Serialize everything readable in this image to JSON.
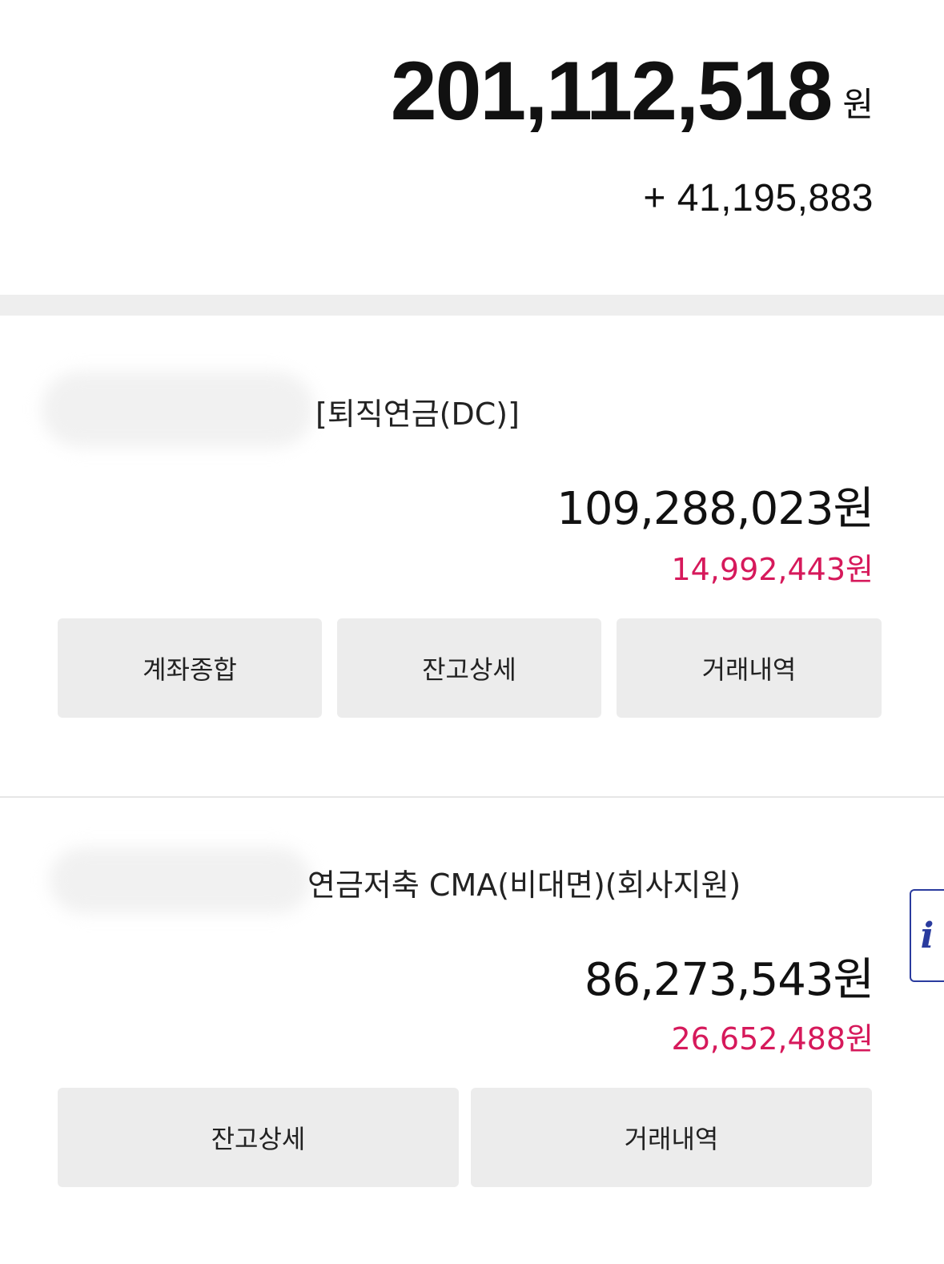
{
  "summary": {
    "total_amount": "201,112,518",
    "total_unit": "원",
    "total_change": "+ 41,195,883"
  },
  "accounts": [
    {
      "name": "[퇴직연금(DC)]",
      "balance": "109,288,023원",
      "profit": "14,992,443원",
      "buttons": [
        "계좌종합",
        "잔고상세",
        "거래내역"
      ]
    },
    {
      "name": "연금저축 CMA(비대면)(회사지원)",
      "balance": "86,273,543원",
      "profit": "26,652,488원",
      "buttons": [
        "잔고상세",
        "거래내역"
      ]
    }
  ],
  "info_tab": {
    "glyph": "i"
  },
  "colors": {
    "profit": "#d6195b",
    "button_bg": "#ececec",
    "info_accent": "#2a3b9e"
  }
}
